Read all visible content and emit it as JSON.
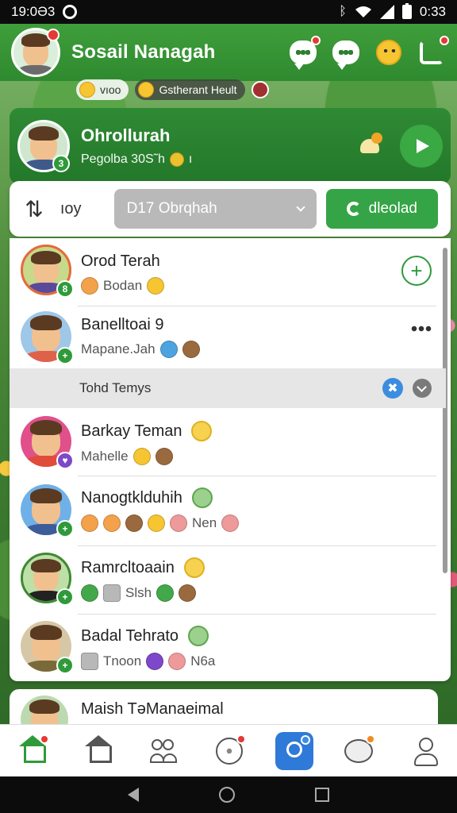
{
  "status_bar": {
    "time": "19:0Ə3",
    "clock_right": "0:33"
  },
  "header": {
    "title": "Sosail Nanagah"
  },
  "chips": [
    {
      "label": "vıoo"
    },
    {
      "label": "Gstherant Heult"
    }
  ],
  "profile": {
    "name": "Ohrollurah",
    "status": "Pegolba 30S˜h",
    "status_suffix": "ı"
  },
  "filter": {
    "sort_label": "ıoy",
    "select_value": "D17 Obrqhah",
    "download_label": "dleolad"
  },
  "section": {
    "label": "Tohd Temys"
  },
  "contacts": [
    {
      "name": "Orod Terah",
      "sub": "Bodan"
    },
    {
      "name": "Banelltoai 9",
      "sub": "Mapane.Jah"
    },
    {
      "name": "Barkay Teman",
      "sub": "Mahelle"
    },
    {
      "name": "Nanogtklduhih",
      "sub": "Nen"
    },
    {
      "name": "Ramrcltoaain",
      "sub": "Slsh"
    },
    {
      "name": "Badal Tehrato",
      "sub": "Tnoon",
      "sub2": "N6a"
    }
  ],
  "peek": {
    "name": "Maish TəManaeimal"
  },
  "colors": {
    "brand_green": "#2f8a2f",
    "accent_blue": "#2f7ad8",
    "badge_red": "#e53935"
  },
  "icons": [
    "chat-bubble-icon",
    "message-icon",
    "smiley-icon",
    "refresh-icon",
    "send-icon",
    "sort-icon",
    "download-icon",
    "add-icon",
    "more-icon",
    "home-icon",
    "house-icon",
    "people-icon",
    "ball-icon",
    "explore-icon",
    "mask-icon",
    "profile-icon"
  ]
}
